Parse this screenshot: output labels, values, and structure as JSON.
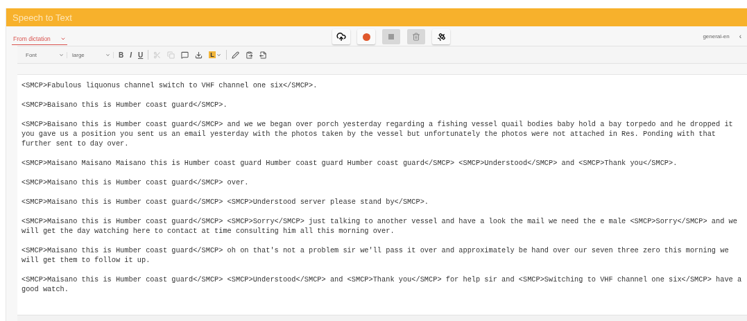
{
  "window": {
    "title": "Speech to Text"
  },
  "tabs": [
    {
      "label": "From dictation",
      "selected": true
    }
  ],
  "controls": [
    {
      "kind": "upload",
      "disabled": false
    },
    {
      "kind": "record",
      "disabled": false
    },
    {
      "kind": "stop",
      "disabled": true
    },
    {
      "kind": "delete",
      "disabled": true
    },
    {
      "kind": "satellite",
      "disabled": false
    }
  ],
  "model": {
    "label": "general-en",
    "arrow": "‹"
  },
  "toolbar": {
    "font": "Font",
    "size": "large",
    "items": [
      {
        "kind": "bold",
        "label": "B",
        "disabled": false
      },
      {
        "kind": "italic",
        "label": "I",
        "disabled": false
      },
      {
        "kind": "underline",
        "label": "U",
        "disabled": false
      },
      {
        "kind": "separator"
      },
      {
        "kind": "cut",
        "disabled": true
      },
      {
        "kind": "copy",
        "disabled": true
      },
      {
        "kind": "comment",
        "disabled": false
      },
      {
        "kind": "download",
        "disabled": false
      },
      {
        "kind": "highlight",
        "label": "L",
        "disabled": false
      },
      {
        "kind": "separator"
      },
      {
        "kind": "pen",
        "disabled": false
      },
      {
        "kind": "paste",
        "disabled": false
      },
      {
        "kind": "export",
        "disabled": false
      }
    ]
  },
  "paragraphs": [
    "<SMCP>Fabulous liquonus channel switch to VHF channel one six</SMCP>.",
    "<SMCP>Baisano this is Humber coast guard</SMCP>.",
    "<SMCP>Baisano this is Humber coast guard</SMCP> and we we began over porch yesterday regarding a fishing vessel quail bodies baby hold a bay torpedo and he dropped it you gave us a position you sent us an email yesterday with the photos taken by the vessel but unfortunately the photos were not attached in Res. Ponding with that further sent to day over.",
    "<SMCP>Maisano Maisano Maisano this is Humber coast guard Humber coast guard Humber coast guard</SMCP> <SMCP>Understood</SMCP> and <SMCP>Thank you</SMCP>.",
    "<SMCP>Maisano this is Humber coast guard</SMCP> over.",
    "<SMCP>Maisano this is Humber coast guard</SMCP> <SMCP>Understood server please stand by</SMCP>.",
    "<SMCP>Maisano this is Humber coast guard</SMCP> <SMCP>Sorry</SMCP> just talking to another vessel and have a look the mail we need the e male <SMCP>Sorry</SMCP> and we will get the day watching here to contact at time consulting him all this morning over.",
    "<SMCP>Maisano this is Humber coast guard</SMCP> oh on that's not a problem sir we'll pass it over and approximately be hand over our seven three zero this morning we will get them to follow it up.",
    "<SMCP>Maisano this is Humber coast guard</SMCP> <SMCP>Understood</SMCP> and <SMCP>Thank you</SMCP> for help sir and <SMCP>Switching to VHF channel one six</SMCP> have a good watch."
  ]
}
